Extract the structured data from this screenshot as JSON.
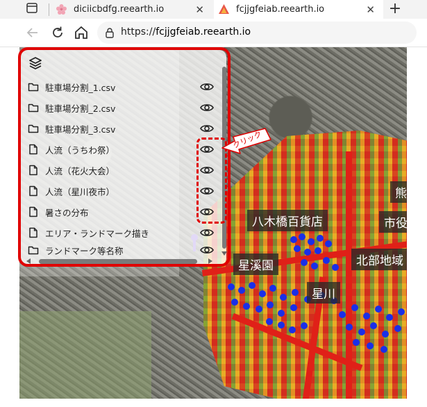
{
  "browser": {
    "tabs": [
      {
        "title": "diciicbdfg.reearth.io",
        "close_glyph": "✕",
        "active": false
      },
      {
        "title": "fcjjgfeiab.reearth.io",
        "close_glyph": "✕",
        "active": true
      }
    ],
    "new_tab_glyph": "+",
    "url": {
      "scheme": "https://",
      "host": "fcjjgfeiab.reearth.io"
    }
  },
  "layer_panel": {
    "header_icon": "layers-icon",
    "items": [
      {
        "name": "駐車場分割_1.csv",
        "icon": "folder-icon"
      },
      {
        "name": "駐車場分割_2.csv",
        "icon": "folder-icon"
      },
      {
        "name": "駐車場分割_3.csv",
        "icon": "folder-icon"
      },
      {
        "name": "人流（うちわ祭）",
        "icon": "file-icon"
      },
      {
        "name": "人流（花火大会）",
        "icon": "file-icon"
      },
      {
        "name": "人流（星川夜市）",
        "icon": "file-icon"
      },
      {
        "name": "暑さの分布",
        "icon": "file-icon"
      },
      {
        "name": "エリア・ランドマーク描き",
        "icon": "file-icon"
      },
      {
        "name": "ランドマーク等名称",
        "icon": "folder-icon"
      }
    ]
  },
  "annotation": {
    "callout_text": "クリック",
    "accent": "#e00000"
  },
  "map_labels": {
    "label1": "八木橋百貨店",
    "label2": "熊",
    "label3": "市役",
    "label4": "星溪園",
    "label5": "北部地域",
    "label6": "星川"
  },
  "colors": {
    "hotspot_dots": "#1a2fe8",
    "road_red": "#e02018"
  }
}
